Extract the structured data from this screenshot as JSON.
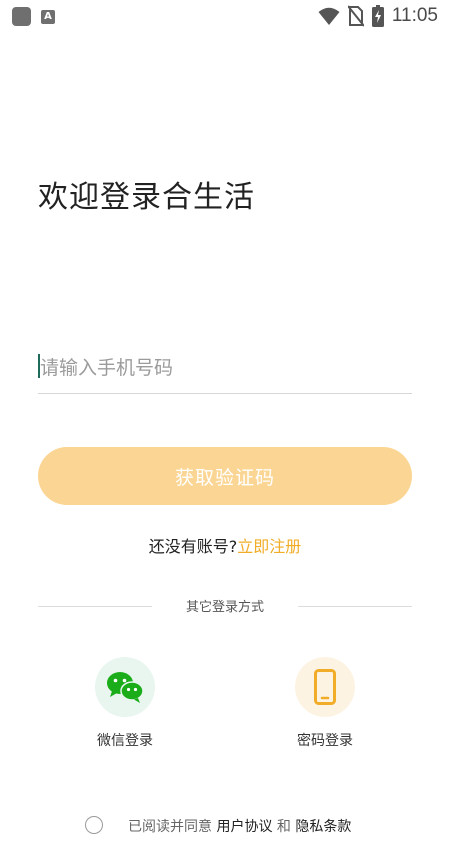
{
  "status_bar": {
    "time": "11:05",
    "a_badge": "A",
    "icons": [
      "notification-square-icon",
      "a-badge-icon",
      "wifi-icon",
      "no-sim-icon",
      "battery-charging-icon"
    ]
  },
  "welcome_title": "欢迎登录合生活",
  "phone_input": {
    "placeholder": "请输入手机号码",
    "value": ""
  },
  "get_code_button": "获取验证码",
  "register": {
    "question": "还没有账号?",
    "link": "立即注册"
  },
  "other_login": {
    "label": "其它登录方式",
    "options": [
      {
        "label": "微信登录",
        "icon": "wechat-icon"
      },
      {
        "label": "密码登录",
        "icon": "phone-icon"
      }
    ]
  },
  "agreement": {
    "prefix": "已阅读并同意",
    "user_agreement": "用户协议",
    "and": "和",
    "privacy": "隐私条款"
  },
  "colors": {
    "accent": "#f1ad28",
    "button_bg": "#fbd593",
    "wechat_green": "#1aad19",
    "caret": "#1e6b5c"
  }
}
